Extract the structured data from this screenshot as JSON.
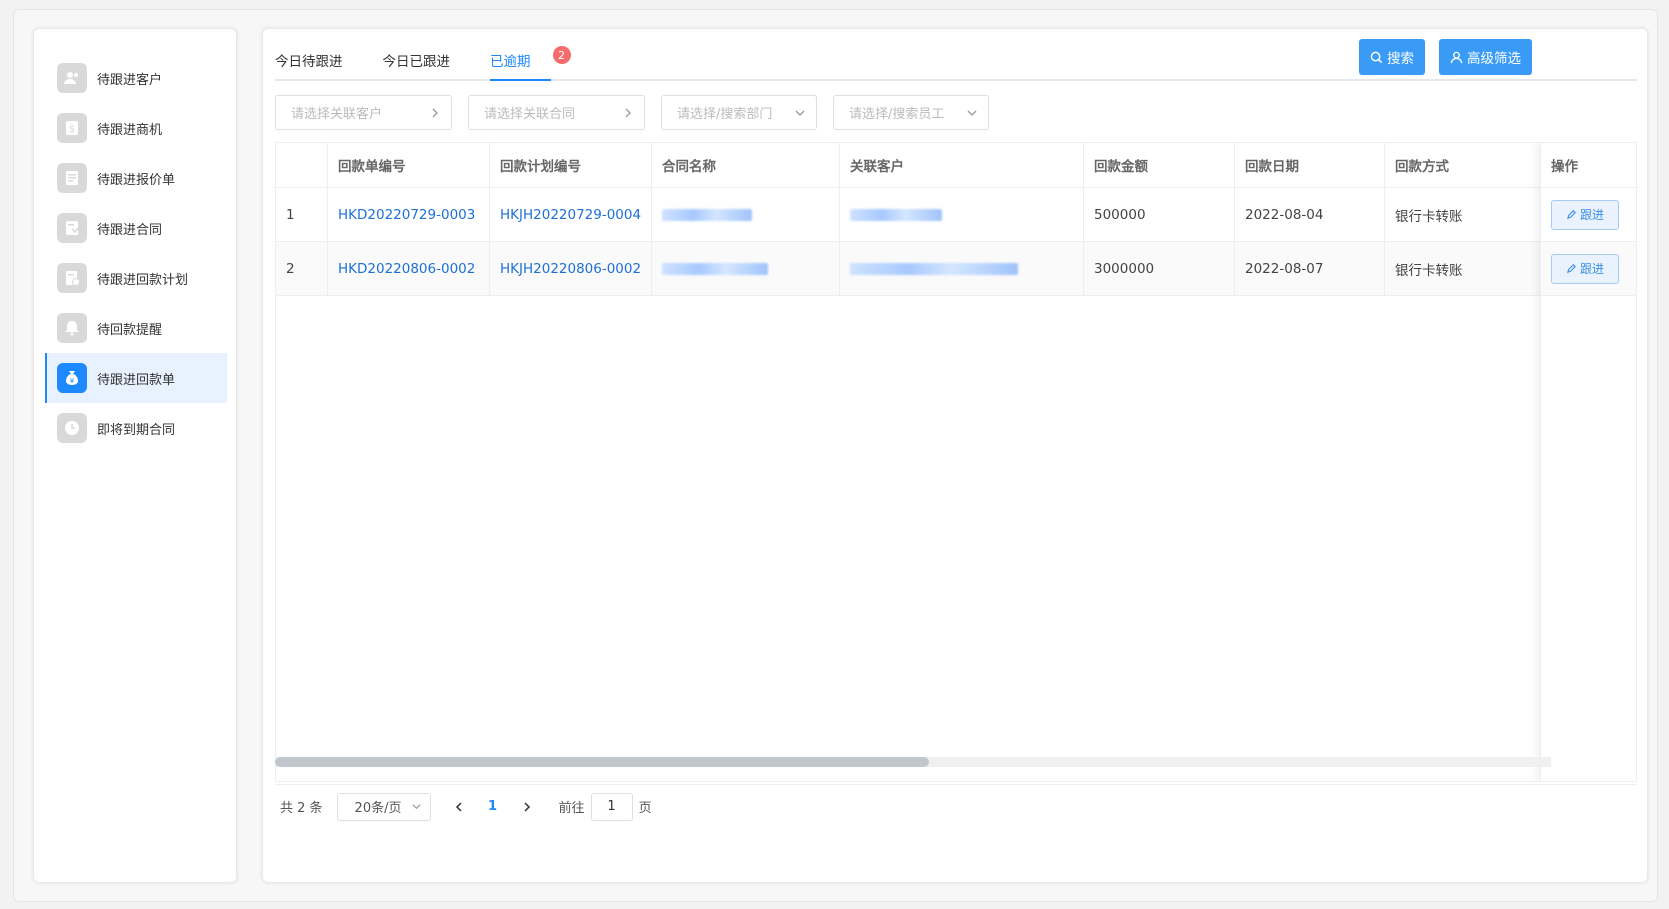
{
  "sidebar": {
    "items": [
      {
        "label": "待跟进客户",
        "icon": "users-icon",
        "active": false
      },
      {
        "label": "待跟进商机",
        "icon": "dollar-icon",
        "active": false
      },
      {
        "label": "待跟进报价单",
        "icon": "document-icon",
        "active": false
      },
      {
        "label": "待跟进合同",
        "icon": "contract-icon",
        "active": false
      },
      {
        "label": "待跟进回款计划",
        "icon": "plan-icon",
        "active": false
      },
      {
        "label": "待回款提醒",
        "icon": "bell-icon",
        "active": false
      },
      {
        "label": "待跟进回款单",
        "icon": "money-bag-icon",
        "active": true
      },
      {
        "label": "即将到期合同",
        "icon": "clock-icon",
        "active": false
      }
    ]
  },
  "tabs": [
    {
      "label": "今日待跟进",
      "active": false
    },
    {
      "label": "今日已跟进",
      "active": false
    },
    {
      "label": "已逾期",
      "active": true,
      "badge": "2"
    }
  ],
  "toolbar": {
    "search_label": "搜索",
    "advanced_filter_label": "高级筛选"
  },
  "filters": {
    "customer_placeholder": "请选择关联客户",
    "contract_placeholder": "请选择关联合同",
    "department_placeholder": "请选择/搜索部门",
    "employee_placeholder": "请选择/搜索员工"
  },
  "table": {
    "headers": [
      "",
      "回款单编号",
      "回款计划编号",
      "合同名称",
      "关联客户",
      "回款金额",
      "回款日期",
      "回款方式"
    ],
    "action_header": "操作",
    "action_label": "跟进",
    "rows": [
      {
        "index": "1",
        "receipt_no": "HKD20220729-0003",
        "plan_no": "HKJH20220729-0004",
        "amount": "500000",
        "date": "2022-08-04",
        "method": "银行卡转账"
      },
      {
        "index": "2",
        "receipt_no": "HKD20220806-0002",
        "plan_no": "HKJH20220806-0002",
        "amount": "3000000",
        "date": "2022-08-07",
        "method": "银行卡转账"
      }
    ]
  },
  "pagination": {
    "total_text": "共 2 条",
    "page_size": "20条/页",
    "current_page": "1",
    "goto_label": "前往",
    "goto_value": "1",
    "page_suffix": "页"
  },
  "colors": {
    "accent": "#1e88ff",
    "badge": "#f56c6c",
    "link": "#1e6fd9"
  }
}
